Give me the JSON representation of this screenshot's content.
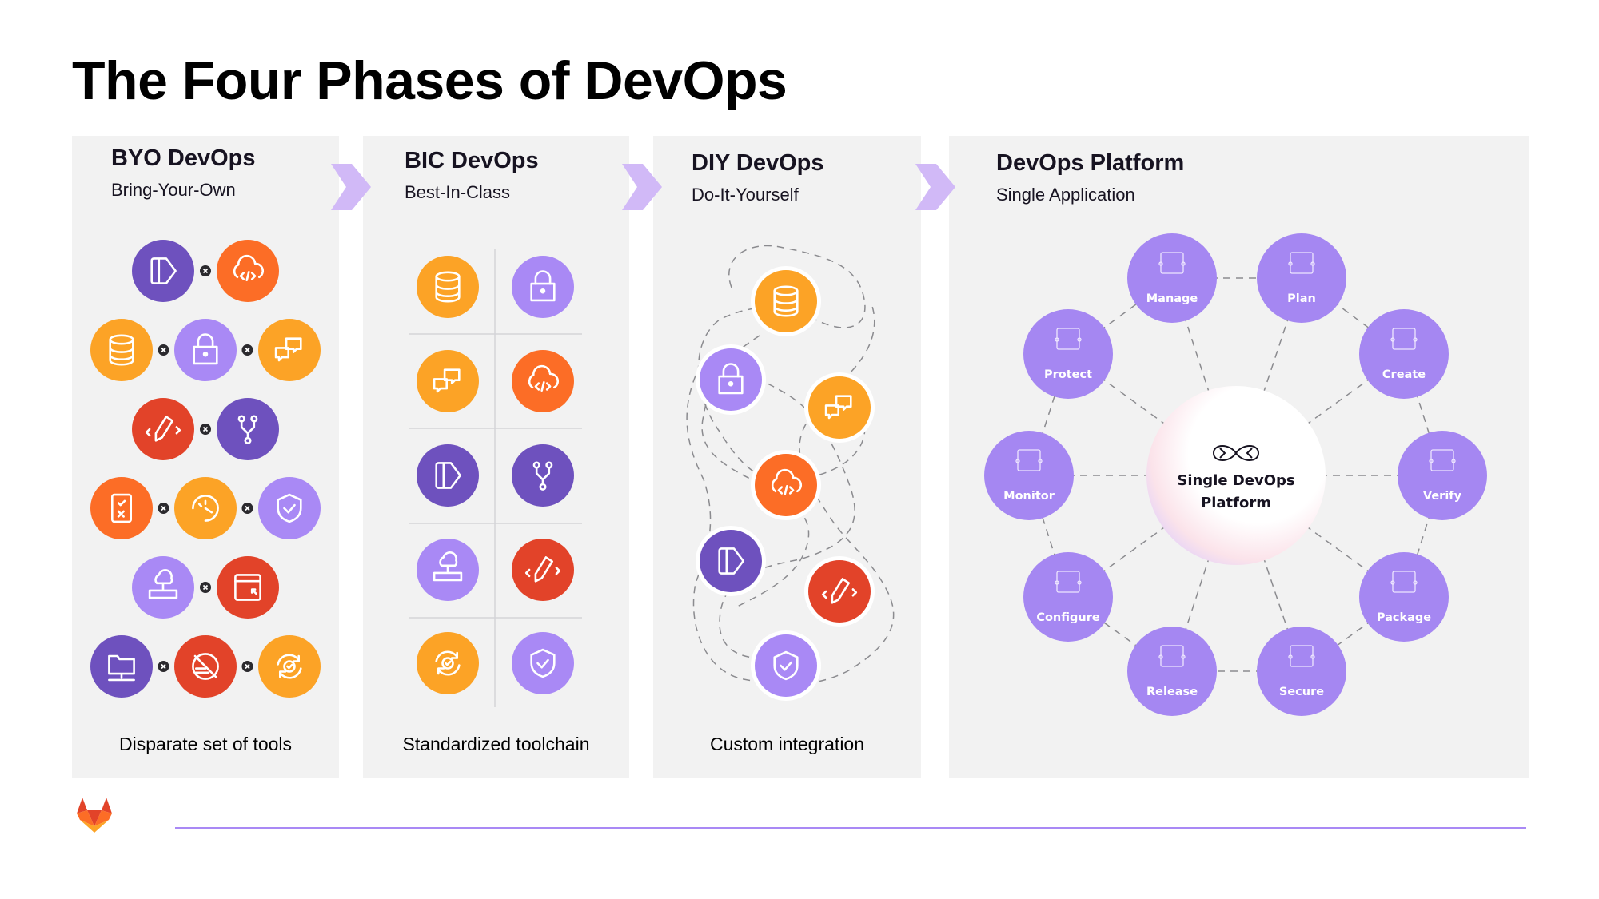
{
  "title": "The Four Phases of DevOps",
  "colors": {
    "panel_bg": "#f2f2f2",
    "chevron": "#d1b9f7",
    "dark_purple": "#6e51be",
    "light_purple": "#a989f5",
    "orange": "#fc6d26",
    "amber": "#fca326",
    "red": "#e24329",
    "platform_node": "#a587f2",
    "footer_line": "#a989f5"
  },
  "phases": [
    {
      "id": "byo",
      "heading": "BYO DevOps",
      "subheading": "Bring-Your-Own",
      "caption": "Disparate set of tools",
      "rows": [
        [
          {
            "icon": "file-play",
            "color": "dark_purple"
          },
          {
            "icon": "cloud-code",
            "color": "orange"
          }
        ],
        [
          {
            "icon": "database",
            "color": "amber"
          },
          {
            "icon": "lock",
            "color": "light_purple"
          },
          {
            "icon": "chat",
            "color": "amber"
          }
        ],
        [
          {
            "icon": "pencil-code",
            "color": "red"
          },
          {
            "icon": "git-branch",
            "color": "dark_purple"
          }
        ],
        [
          {
            "icon": "checklist",
            "color": "orange"
          },
          {
            "icon": "gauge",
            "color": "amber"
          },
          {
            "icon": "shield-check",
            "color": "light_purple"
          }
        ],
        [
          {
            "icon": "cloud-server",
            "color": "light_purple"
          },
          {
            "icon": "browser-cursor",
            "color": "red"
          }
        ],
        [
          {
            "icon": "folder-network",
            "color": "dark_purple"
          },
          {
            "icon": "chart-off",
            "color": "red"
          },
          {
            "icon": "sync-check",
            "color": "amber"
          }
        ]
      ]
    },
    {
      "id": "bic",
      "heading": "BIC DevOps",
      "subheading": "Best-In-Class",
      "caption": "Standardized toolchain",
      "grid": [
        [
          {
            "icon": "database",
            "color": "amber"
          },
          {
            "icon": "lock",
            "color": "light_purple"
          }
        ],
        [
          {
            "icon": "chat",
            "color": "amber"
          },
          {
            "icon": "cloud-code",
            "color": "orange"
          }
        ],
        [
          {
            "icon": "file-play",
            "color": "dark_purple"
          },
          {
            "icon": "git-branch",
            "color": "dark_purple"
          }
        ],
        [
          {
            "icon": "cloud-server",
            "color": "light_purple"
          },
          {
            "icon": "pencil-code",
            "color": "red"
          }
        ],
        [
          {
            "icon": "sync-check",
            "color": "amber"
          },
          {
            "icon": "shield-check",
            "color": "light_purple"
          }
        ]
      ]
    },
    {
      "id": "diy",
      "heading": "DIY DevOps",
      "subheading": "Do-It-Yourself",
      "caption": "Custom integration",
      "nodes": [
        {
          "icon": "database",
          "color": "amber"
        },
        {
          "icon": "lock",
          "color": "light_purple"
        },
        {
          "icon": "chat",
          "color": "amber"
        },
        {
          "icon": "cloud-code",
          "color": "orange"
        },
        {
          "icon": "file-play",
          "color": "dark_purple"
        },
        {
          "icon": "pencil-code",
          "color": "red"
        },
        {
          "icon": "shield-check",
          "color": "light_purple"
        }
      ]
    },
    {
      "id": "platform",
      "heading": "DevOps Platform",
      "subheading": "Single Application",
      "center": {
        "line1": "Single DevOps",
        "line2": "Platform",
        "icon": "infinity-loop"
      },
      "stages": [
        {
          "label": "Manage",
          "icon": "analytics"
        },
        {
          "label": "Plan",
          "icon": "planner"
        },
        {
          "label": "Create",
          "icon": "edit"
        },
        {
          "label": "Verify",
          "icon": "badge-check"
        },
        {
          "label": "Package",
          "icon": "code-box"
        },
        {
          "label": "Secure",
          "icon": "lock"
        },
        {
          "label": "Release",
          "icon": "release-cycle"
        },
        {
          "label": "Configure",
          "icon": "gear-sliders"
        },
        {
          "label": "Monitor",
          "icon": "monitor-pulse"
        },
        {
          "label": "Protect",
          "icon": "shield-check"
        }
      ]
    }
  ],
  "footer": {
    "logo": "gitlab-tanuki"
  }
}
